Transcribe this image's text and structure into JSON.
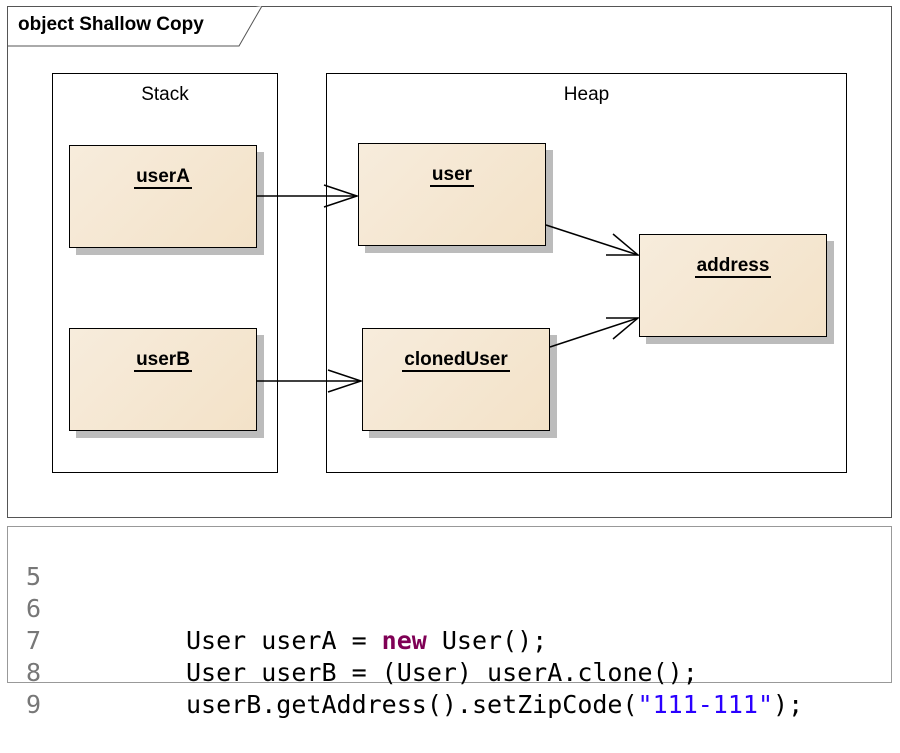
{
  "frame": {
    "title": "object Shallow  Copy"
  },
  "containers": {
    "stack": {
      "label": "Stack"
    },
    "heap": {
      "label": "Heap"
    }
  },
  "nodes": {
    "userA": "userA",
    "userB": "userB",
    "user": "user",
    "clonedUser": "clonedUser",
    "address": "address"
  },
  "code": {
    "lines": [
      {
        "number": "5",
        "segments": []
      },
      {
        "number": "6",
        "segments": [
          {
            "text": "User userA = ",
            "style": "plain"
          },
          {
            "text": "new",
            "style": "keyword"
          },
          {
            "text": " User();",
            "style": "plain"
          }
        ]
      },
      {
        "number": "7",
        "segments": [
          {
            "text": "User userB = (User) userA.clone();",
            "style": "plain"
          }
        ]
      },
      {
        "number": "8",
        "segments": [
          {
            "text": "userB.getAddress().setZipCode(",
            "style": "plain"
          },
          {
            "text": "\"111-111\"",
            "style": "string"
          },
          {
            "text": ");",
            "style": "plain"
          }
        ]
      },
      {
        "number": "9",
        "segments": []
      }
    ],
    "colors": {
      "keyword": "#7f0055",
      "string": "#2a00ff",
      "line_number": "#777777"
    }
  }
}
